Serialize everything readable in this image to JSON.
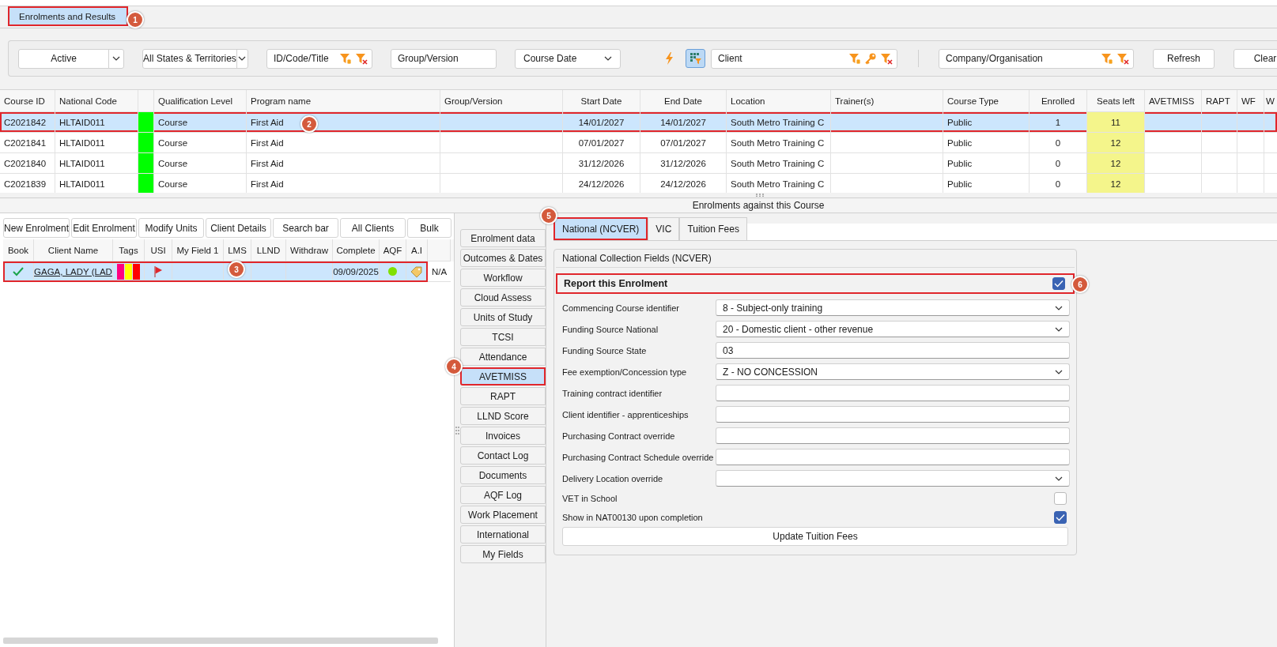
{
  "module_tab": {
    "label": "Enrolments and Results",
    "selected": true,
    "callout": "1"
  },
  "filters": [
    {
      "kind": "combo",
      "value": "Active"
    },
    {
      "kind": "combo",
      "value": "All States & Territories"
    },
    {
      "kind": "lookup",
      "placeholder": "ID/Code/Title"
    },
    {
      "kind": "text",
      "placeholder": "Group/Version"
    },
    {
      "kind": "dropdown",
      "value": "Course Date"
    },
    {
      "kind": "action"
    },
    {
      "kind": "toggle",
      "selected": true
    },
    {
      "kind": "lookup_key",
      "placeholder": "Client"
    },
    {
      "kind": "separator"
    },
    {
      "kind": "lookup",
      "placeholder": "Company/Organisation"
    },
    {
      "kind": "button",
      "label": "Refresh"
    },
    {
      "kind": "button",
      "label": "Clear"
    }
  ],
  "courses": {
    "columns": [
      "Course ID",
      "National Code",
      null,
      "Qualification Level",
      "Program name",
      "Group/Version",
      "Start Date",
      "End Date",
      "Location",
      "Trainer(s)",
      "Course Type",
      "Enrolled",
      "Seats left",
      "AVETMISS",
      "RAPT",
      "WF",
      "W"
    ],
    "rows": [
      {
        "selected": true,
        "callout": "2",
        "color": "#00ff00",
        "cells": [
          "C2021842",
          "HLTAID011",
          null,
          "Course",
          "First Aid",
          null,
          "14/01/2027",
          "14/01/2027",
          "South Metro Training C",
          null,
          "Public",
          "1",
          "11",
          null,
          null,
          null,
          null
        ]
      },
      {
        "selected": false,
        "color": "#00ff00",
        "cells": [
          "C2021841",
          "HLTAID011",
          null,
          "Course",
          "First Aid",
          null,
          "07/01/2027",
          "07/01/2027",
          "South Metro Training C",
          null,
          "Public",
          "0",
          "12",
          null,
          null,
          null,
          null
        ]
      },
      {
        "selected": false,
        "color": "#00ff00",
        "cells": [
          "C2021840",
          "HLTAID011",
          null,
          "Course",
          "First Aid",
          null,
          "31/12/2026",
          "31/12/2026",
          "South Metro Training C",
          null,
          "Public",
          "0",
          "12",
          null,
          null,
          null,
          null
        ]
      },
      {
        "selected": false,
        "color": "#00ff00",
        "cells": [
          "C2021839",
          "HLTAID011",
          null,
          "Course",
          "First Aid",
          null,
          "24/12/2026",
          "24/12/2026",
          "South Metro Training C",
          null,
          "Public",
          "0",
          "12",
          null,
          null,
          null,
          null
        ]
      }
    ]
  },
  "section_title": "Enrolments against this Course",
  "enrolment_buttons": [
    "New Enrolment",
    "Edit Enrolment",
    "Modify Units",
    "Client Details",
    "Search bar",
    "All Clients",
    "Bulk"
  ],
  "enrolments": {
    "columns": [
      "Book",
      "Client Name",
      "Tags",
      "USI",
      "My Field 1",
      "LMS",
      "LLND",
      "Withdraw",
      "Complete",
      "AQF",
      "A.I",
      null
    ],
    "rows": [
      {
        "selected": true,
        "callout": "3",
        "booked": true,
        "client_name": "GAGA, LADY (LAD",
        "tags": [
          {
            "color": "#ff0080"
          },
          {
            "color": "#ffff00"
          },
          {
            "color": "#ff0000"
          }
        ],
        "usi_flagged": true,
        "complete": "09/09/2025",
        "aqf_status": {
          "color": "#80e000"
        },
        "ai_tagged": true,
        "column_12": "N/A"
      }
    ]
  },
  "side_tabs": [
    {
      "label": "Enrolment data",
      "selected": false
    },
    {
      "label": "Outcomes & Dates",
      "selected": false
    },
    {
      "label": "Workflow",
      "selected": false
    },
    {
      "label": "Cloud Assess",
      "selected": false
    },
    {
      "label": "Units of Study",
      "selected": false
    },
    {
      "label": "TCSI",
      "selected": false
    },
    {
      "label": "Attendance",
      "selected": false
    },
    {
      "label": "AVETMISS",
      "selected": true,
      "callout": "4"
    },
    {
      "label": "RAPT",
      "selected": false
    },
    {
      "label": "LLND Score",
      "selected": false
    },
    {
      "label": "Invoices",
      "selected": false
    },
    {
      "label": "Contact Log",
      "selected": false
    },
    {
      "label": "Documents",
      "selected": false
    },
    {
      "label": "AQF Log",
      "selected": false
    },
    {
      "label": "Work Placement",
      "selected": false
    },
    {
      "label": "International",
      "selected": false
    },
    {
      "label": "My Fields",
      "selected": false
    }
  ],
  "sub_tabs": [
    {
      "label": "National (NCVER)",
      "selected": true,
      "callout": "5"
    },
    {
      "label": "VIC",
      "selected": false
    },
    {
      "label": "Tuition Fees",
      "selected": false
    }
  ],
  "form": {
    "title": "National Collection Fields (NCVER)",
    "report": {
      "label": "Report this Enrolment",
      "checked": true,
      "callout": "6"
    },
    "fields": [
      {
        "kind": "dropdown",
        "label": "Commencing Course identifier",
        "value": "8 - Subject-only training"
      },
      {
        "kind": "dropdown",
        "label": "Funding Source National",
        "value": "20 - Domestic client - other revenue"
      },
      {
        "kind": "text",
        "label": "Funding Source State",
        "value": "03"
      },
      {
        "kind": "dropdown",
        "label": "Fee exemption/Concession type",
        "value": "Z - NO CONCESSION"
      },
      {
        "kind": "text",
        "label": "Training contract identifier"
      },
      {
        "kind": "text",
        "label": "Client identifier - apprenticeships"
      },
      {
        "kind": "text",
        "label": "Purchasing Contract override"
      },
      {
        "kind": "text",
        "label": "Purchasing Contract Schedule override"
      },
      {
        "kind": "dropdown",
        "label": "Delivery Location override"
      },
      {
        "kind": "checkbox",
        "label": "VET in School",
        "checked": false
      },
      {
        "kind": "checkbox",
        "label": "Show in NAT00130 upon completion",
        "checked": true
      }
    ],
    "button": "Update Tuition Fees"
  }
}
